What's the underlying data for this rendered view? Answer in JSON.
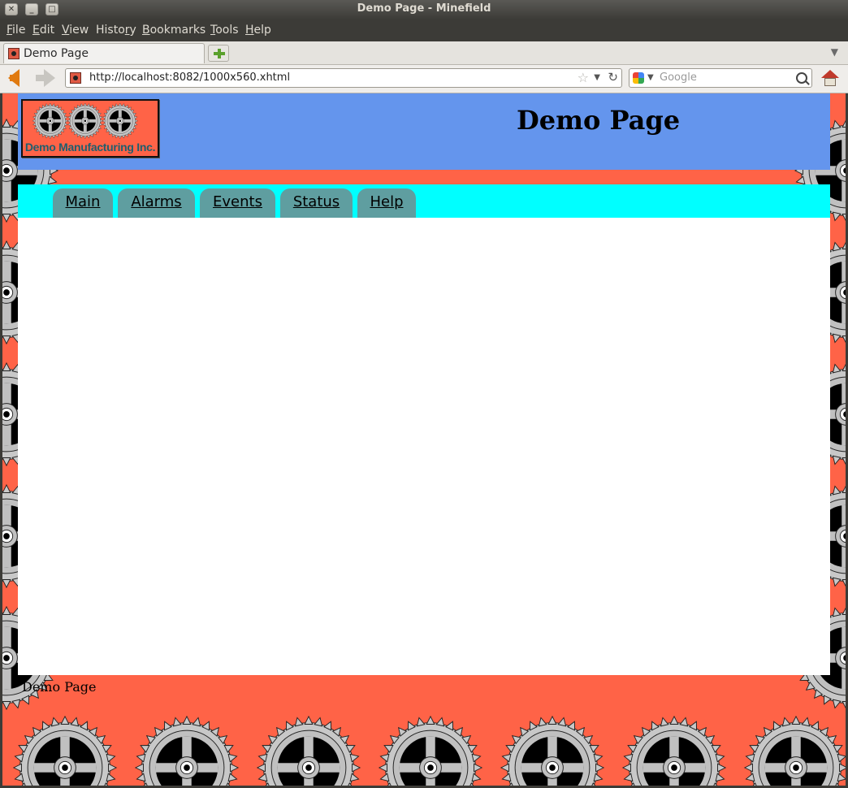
{
  "window": {
    "title": "Demo Page - Minefield"
  },
  "menubar": {
    "items": [
      {
        "label": "File"
      },
      {
        "label": "Edit"
      },
      {
        "label": "View"
      },
      {
        "label": "History"
      },
      {
        "label": "Bookmarks"
      },
      {
        "label": "Tools"
      },
      {
        "label": "Help"
      }
    ]
  },
  "tabs": {
    "active_label": "Demo Page"
  },
  "navbar": {
    "url": "http://localhost:8082/1000x560.xhtml",
    "search_placeholder": "Google",
    "search_engine_icon": "google-icon"
  },
  "page": {
    "logo_text": "Demo Manufacturing Inc.",
    "title": "Demo Page",
    "nav_tabs": [
      "Main",
      "Alarms",
      "Events",
      "Status",
      "Help"
    ],
    "footer_text": "Demo Page",
    "colors": {
      "background": "#ff6347",
      "header": "#6495ed",
      "nav_strip": "#00ffff",
      "nav_tab": "#5f9ea0",
      "content": "#ffffff"
    }
  }
}
